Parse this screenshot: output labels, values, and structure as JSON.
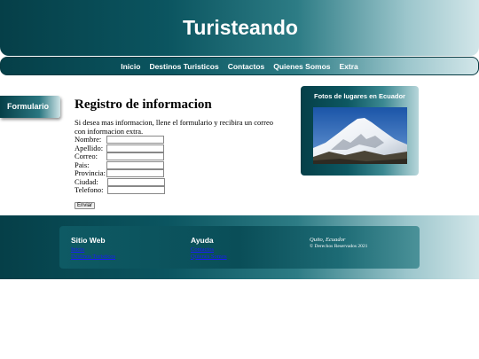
{
  "header": {
    "title": "Turisteando"
  },
  "nav": {
    "items": [
      "Inicio",
      "Destinos Turisticos",
      "Contactos",
      "Quienes Somos",
      "Extra"
    ]
  },
  "side_tab": {
    "label": "Formulario"
  },
  "form": {
    "heading": "Registro de informacion",
    "intro": "Si desea mas informacion, llene el formulario y recibira un correo con informacion extra.",
    "fields": [
      {
        "label": "Nombre:",
        "value": ""
      },
      {
        "label": "Apellido:",
        "value": ""
      },
      {
        "label": "Correo:",
        "value": ""
      },
      {
        "label": "Pais:",
        "value": ""
      },
      {
        "label": "Provincia:",
        "value": ""
      },
      {
        "label": "Ciudad:",
        "value": ""
      },
      {
        "label": "Telefono:",
        "value": ""
      }
    ],
    "submit_label": "Enviar"
  },
  "photo_box": {
    "title": "Fotos de lugares en Ecuador",
    "image_alt": "Chimborazo"
  },
  "footer": {
    "col1": {
      "title": "Sitio Web",
      "links": [
        "Inicio",
        "Destinos Turisticos"
      ]
    },
    "col2": {
      "title": "Ayuda",
      "links": [
        "Contactos",
        "Quienes Somos"
      ]
    },
    "col3": {
      "location": "Quito, Ecuador",
      "rights": "© Derechos Reservados 2021"
    }
  },
  "colors": {
    "dark_teal": "#053f48",
    "light_teal": "#d2e6e9",
    "link": "#1a1aff"
  }
}
